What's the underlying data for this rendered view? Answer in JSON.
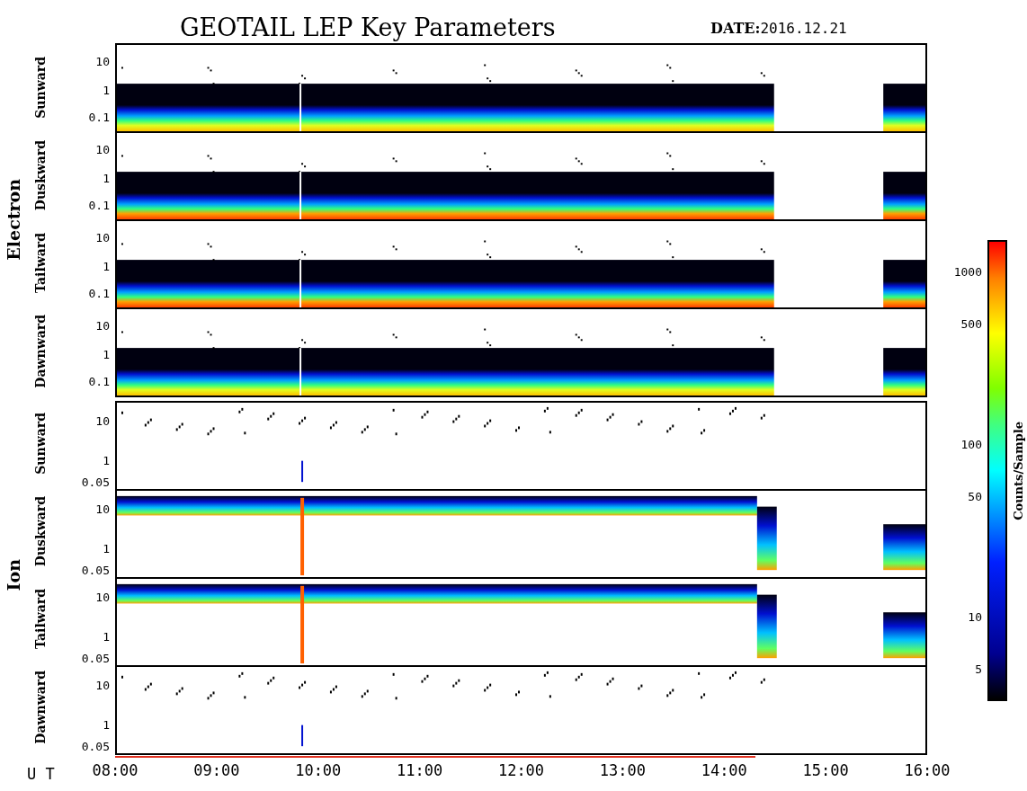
{
  "title": "GEOTAIL LEP Key Parameters",
  "date": {
    "label": "DATE:",
    "value": "2016.12.21"
  },
  "groups": [
    {
      "name": "Electron",
      "panels": [
        {
          "name": "Sunward",
          "kind": "electron",
          "yticks": [
            "10",
            "1",
            "0.1"
          ]
        },
        {
          "name": "Duskward",
          "kind": "electron_hot",
          "yticks": [
            "10",
            "1",
            "0.1"
          ]
        },
        {
          "name": "Tailward",
          "kind": "electron_hot",
          "yticks": [
            "10",
            "1",
            "0.1"
          ]
        },
        {
          "name": "Dawnward",
          "kind": "electron",
          "yticks": [
            "10",
            "1",
            "0.1"
          ]
        }
      ]
    },
    {
      "name": "Ion",
      "panels": [
        {
          "name": "Sunward",
          "kind": "ion_sparse",
          "yticks": [
            "10",
            "1",
            "0.05"
          ]
        },
        {
          "name": "Duskward",
          "kind": "ion_dense",
          "yticks": [
            "10",
            "1",
            "0.05"
          ]
        },
        {
          "name": "Tailward",
          "kind": "ion_dense",
          "yticks": [
            "10",
            "1",
            "0.05"
          ]
        },
        {
          "name": "Dawnward",
          "kind": "ion_sparse",
          "yticks": [
            "10",
            "1",
            "0.05"
          ]
        }
      ]
    }
  ],
  "colorbar": {
    "label": "Counts/Sample",
    "ticks": [
      "1000",
      "500",
      "100",
      "50",
      "10",
      "5"
    ]
  },
  "xaxis": {
    "label": "U T",
    "ticks": [
      "08:00",
      "09:00",
      "10:00",
      "11:00",
      "12:00",
      "13:00",
      "14:00",
      "15:00",
      "16:00"
    ]
  }
}
